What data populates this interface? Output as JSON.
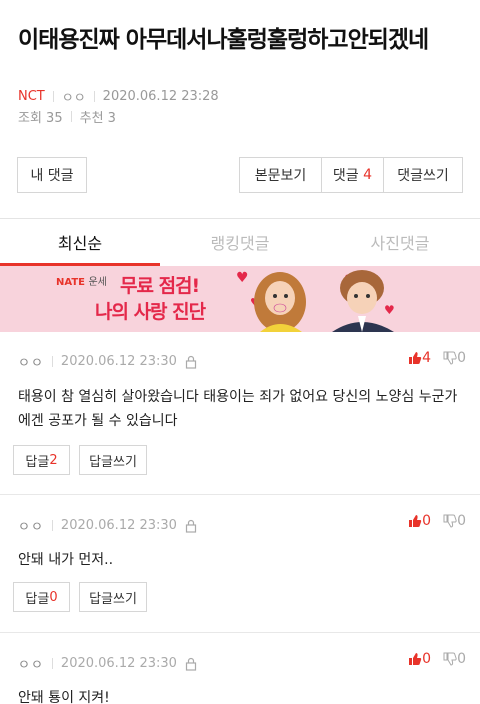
{
  "post": {
    "title": "이태용진짜 아무데서나훌렁훌렁하고안되겠네",
    "category": "NCT",
    "author": "ㅇㅇ",
    "datetime": "2020.06.12 23:28",
    "views_label": "조회 35",
    "likes_label": "추천 3"
  },
  "toolbar": {
    "my_comments": "내 댓글",
    "view_post": "본문보기",
    "comments_label": "댓글",
    "comments_count": "4",
    "write_comment": "댓글쓰기"
  },
  "tabs": [
    "최신순",
    "랭킹댓글",
    "사진댓글"
  ],
  "banner": {
    "brand": "NATE",
    "service": "운세",
    "line1": "무료 점검!",
    "line2": "나의 사랑 진단"
  },
  "comments": [
    {
      "author": "ㅇㅇ",
      "datetime": "2020.06.12 23:30",
      "up": "4",
      "down": "0",
      "text": "태용이 참 열심히 살아왔습니다 태용이는 죄가 없어요 당신의 노양심 누군가에겐 공포가 될 수 있습니다",
      "reply_label": "답글",
      "reply_count": "2",
      "write_reply": "답글쓰기"
    },
    {
      "author": "ㅇㅇ",
      "datetime": "2020.06.12 23:30",
      "up": "0",
      "down": "0",
      "text": "안돼 내가 먼저..",
      "reply_label": "답글",
      "reply_count": "0",
      "write_reply": "답글쓰기"
    },
    {
      "author": "ㅇㅇ",
      "datetime": "2020.06.12 23:30",
      "up": "0",
      "down": "0",
      "text": "안돼 툥이 지켜!"
    }
  ],
  "colors": {
    "accent": "#e8332a",
    "banner_bg": "#f8d3dc",
    "banner_text": "#e4284a"
  }
}
